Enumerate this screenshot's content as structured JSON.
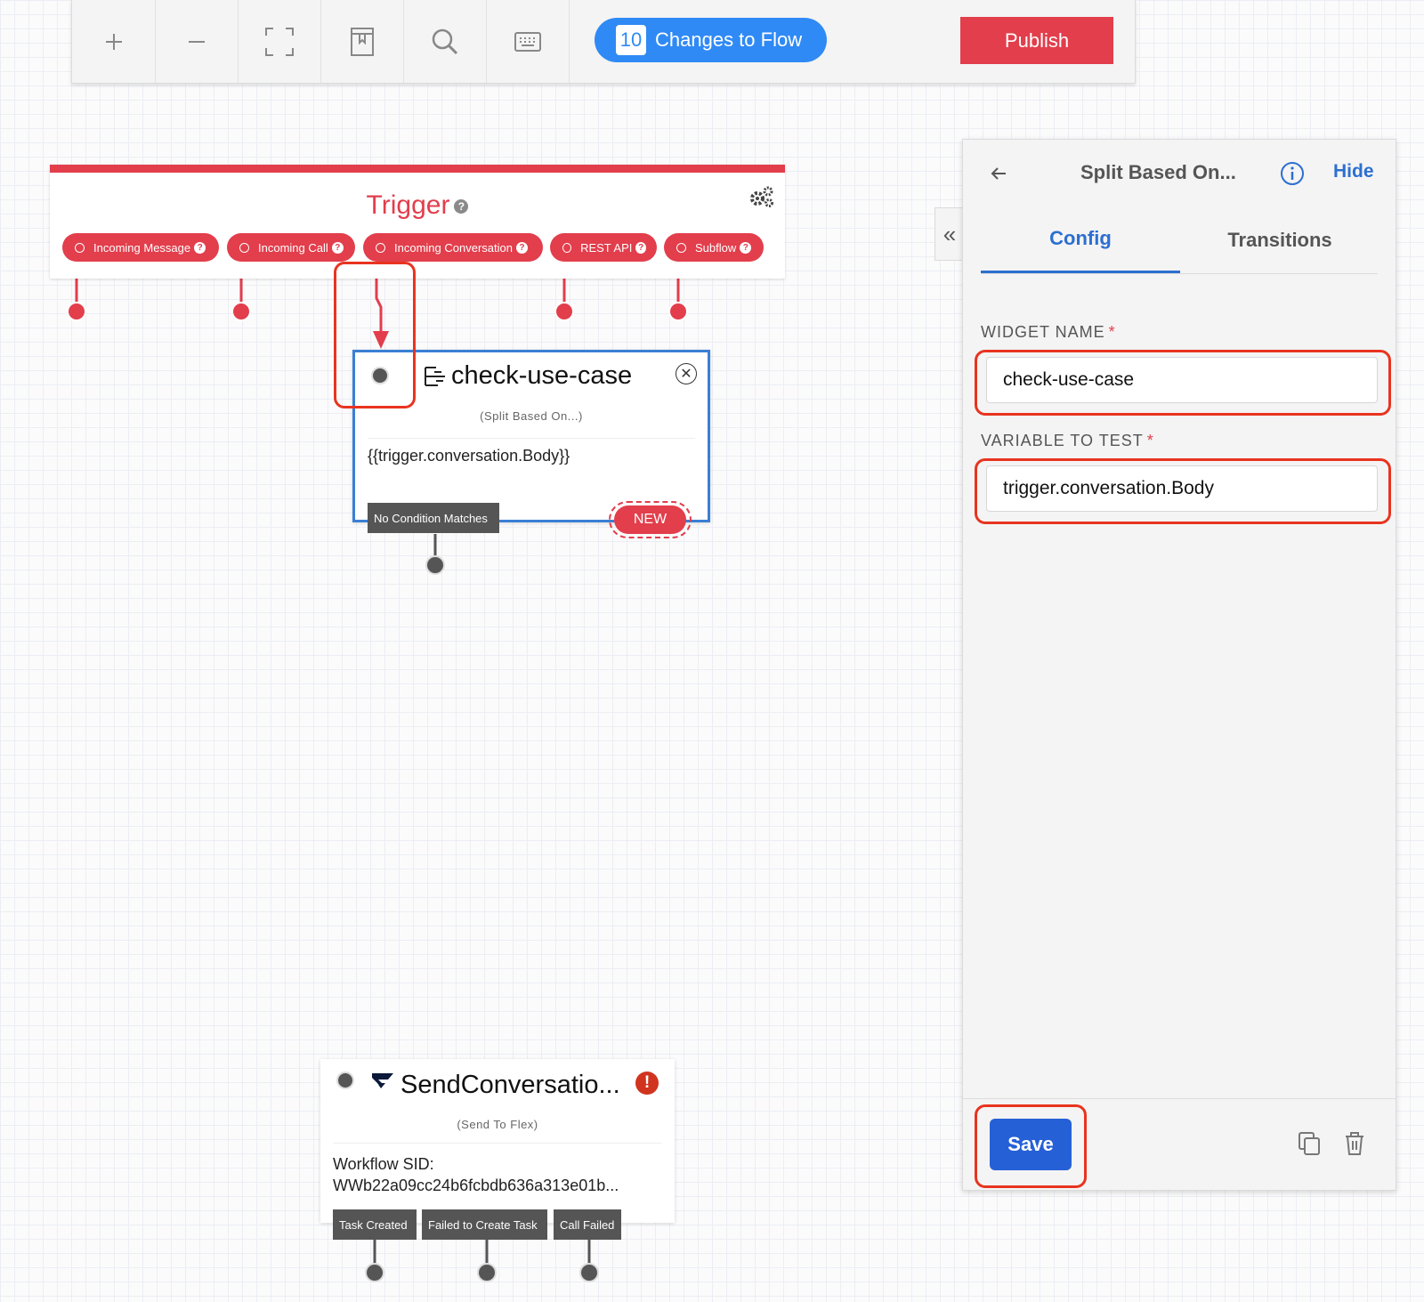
{
  "toolbar": {
    "changes_count": "10",
    "changes_label": "Changes to Flow",
    "publish_label": "Publish",
    "buttons": [
      "zoom-in-icon",
      "zoom-out-icon",
      "fit-screen-icon",
      "bookmark-icon",
      "search-icon",
      "keyboard-icon"
    ]
  },
  "trigger": {
    "title": "Trigger",
    "help": "?",
    "pills": [
      {
        "label": "Incoming Message"
      },
      {
        "label": "Incoming Call"
      },
      {
        "label": "Incoming Conversation"
      },
      {
        "label": "REST API"
      },
      {
        "label": "Subflow"
      }
    ]
  },
  "widget_split": {
    "title": "check-use-case",
    "subtitle": "(Split Based On...)",
    "body": "{{trigger.conversation.Body}}",
    "no_condition": "No Condition Matches",
    "new_badge": "NEW"
  },
  "widget_flex": {
    "title": "SendConversatio...",
    "subtitle": "(Send To Flex)",
    "body_label": "Workflow SID:",
    "body_value": "WWb22a09cc24b6fcbdb636a313e01b...",
    "transitions": [
      "Task Created",
      "Failed to Create Task",
      "Call Failed"
    ]
  },
  "panel": {
    "title": "Split Based On...",
    "hide_label": "Hide",
    "tabs": [
      {
        "label": "Config",
        "active": true
      },
      {
        "label": "Transitions",
        "active": false
      }
    ],
    "widget_name_label": "WIDGET NAME",
    "widget_name_value": "check-use-case",
    "variable_label": "VARIABLE TO TEST",
    "variable_value": "trigger.conversation.Body",
    "required_marker": "*",
    "save_label": "Save"
  },
  "colors": {
    "accent_red": "#e23e4c",
    "accent_blue": "#2f8af5",
    "save_blue": "#2660d6",
    "highlight": "#e8341f"
  }
}
